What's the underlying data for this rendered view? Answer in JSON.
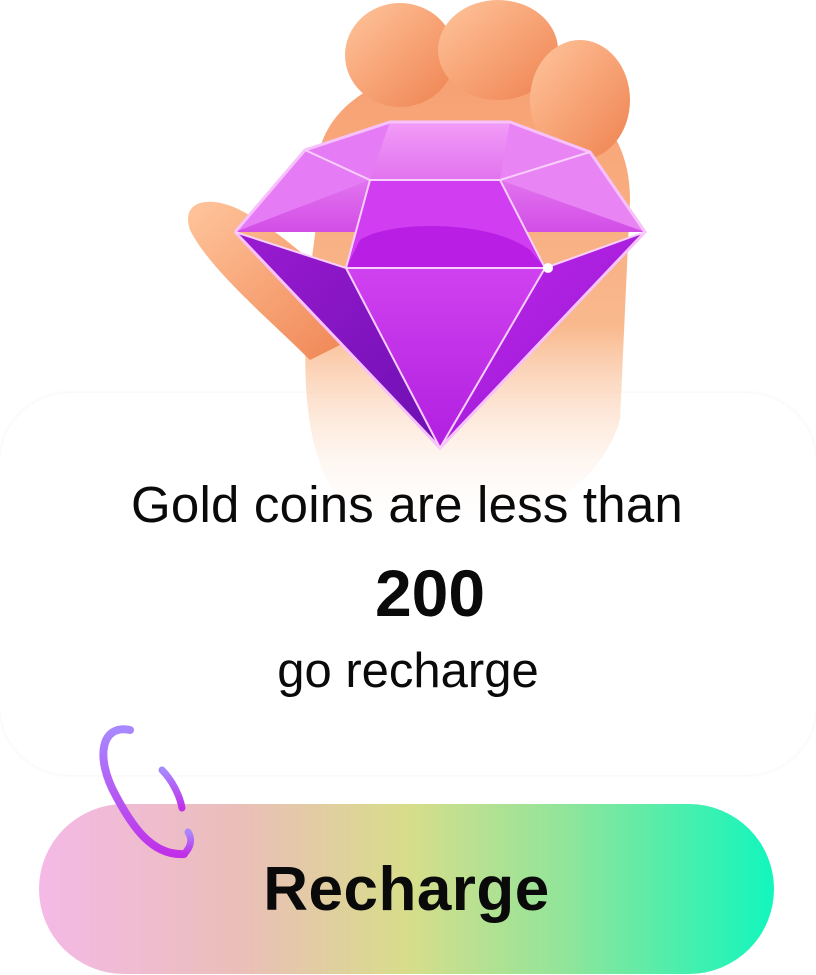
{
  "dialog": {
    "message_line1": "Gold coins are less than",
    "threshold": "200",
    "message_line3": "go recharge"
  },
  "button": {
    "label": "Recharge"
  },
  "icons": {
    "hero": "hand-holding-diamond-icon",
    "decoration": "swirl-icon"
  },
  "colors": {
    "diamond": "#b21fe0",
    "button_gradient_start": "#f4b9e6",
    "button_gradient_end": "#12f6bd"
  }
}
